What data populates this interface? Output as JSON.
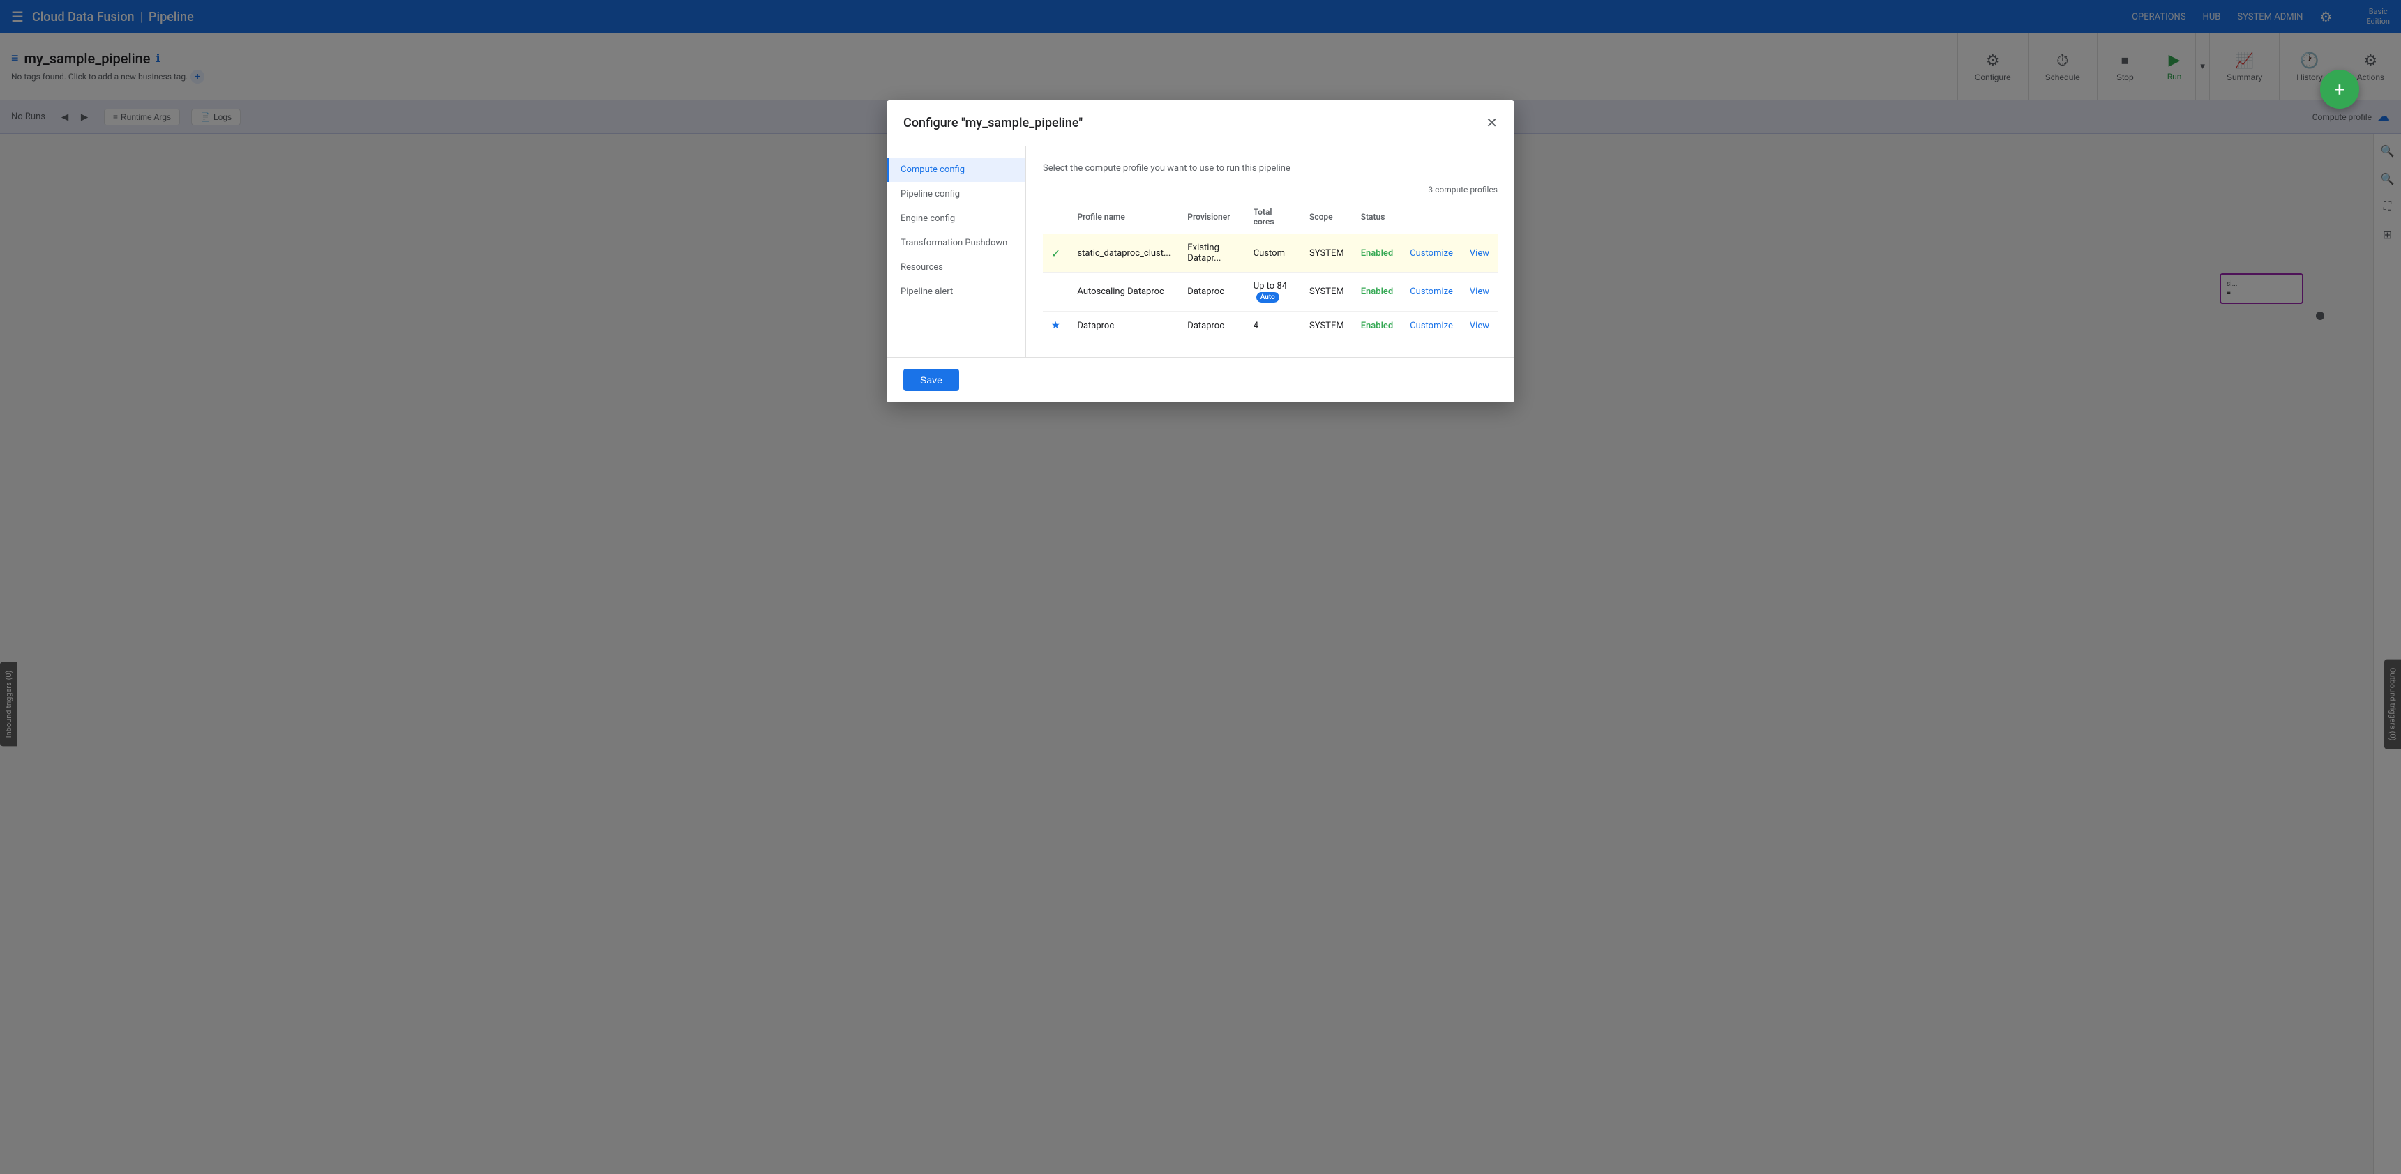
{
  "app": {
    "brand": "Cloud Data Fusion",
    "separator": "|",
    "section": "Pipeline",
    "edition": "Basic\nEdition"
  },
  "topnav": {
    "operations": "OPERATIONS",
    "hub": "HUB",
    "system_admin": "SYSTEM ADMIN"
  },
  "pipeline": {
    "name": "my_sample_pipeline",
    "tags_placeholder": "No tags found. Click to add a new business tag.",
    "add_tag_icon": "+"
  },
  "toolbar": {
    "configure_label": "Configure",
    "schedule_label": "Schedule",
    "stop_label": "Stop",
    "run_label": "Run",
    "summary_label": "Summary",
    "history_label": "History",
    "actions_label": "Actions"
  },
  "run_history": {
    "no_runs": "No Runs",
    "runtime_args": "Runtime Args",
    "logs": "Logs",
    "compute_profile": "Compute profile"
  },
  "modal": {
    "title": "Configure \"my_sample_pipeline\"",
    "description": "Select the compute profile you want to use to run this pipeline",
    "profiles_count": "3 compute profiles",
    "nav_items": [
      {
        "id": "compute-config",
        "label": "Compute config",
        "active": true
      },
      {
        "id": "pipeline-config",
        "label": "Pipeline config",
        "active": false
      },
      {
        "id": "engine-config",
        "label": "Engine config",
        "active": false
      },
      {
        "id": "transformation-pushdown",
        "label": "Transformation Pushdown",
        "active": false
      },
      {
        "id": "resources",
        "label": "Resources",
        "active": false
      },
      {
        "id": "pipeline-alert",
        "label": "Pipeline alert",
        "active": false
      }
    ],
    "table": {
      "headers": [
        "Profile name",
        "Provisioner",
        "Total cores",
        "Scope",
        "Status",
        "",
        ""
      ],
      "rows": [
        {
          "selected": true,
          "check": "✓",
          "profile_name": "static_dataproc_clust...",
          "provisioner": "Existing Datapr...",
          "total_cores": "Custom",
          "scope": "SYSTEM",
          "status": "Enabled",
          "customize": "Customize",
          "view": "View",
          "badge": null,
          "star": null
        },
        {
          "selected": false,
          "check": null,
          "profile_name": "Autoscaling Dataproc",
          "provisioner": "Dataproc",
          "total_cores": "Up to 84",
          "scope": "SYSTEM",
          "status": "Enabled",
          "customize": "Customize",
          "view": "View",
          "badge": "Auto",
          "star": null
        },
        {
          "selected": false,
          "check": null,
          "profile_name": "Dataproc",
          "provisioner": "Dataproc",
          "total_cores": "4",
          "scope": "SYSTEM",
          "status": "Enabled",
          "customize": "Customize",
          "view": "View",
          "badge": null,
          "star": "★"
        }
      ]
    },
    "save_label": "Save"
  },
  "triggers": {
    "inbound": "Inbound triggers (0)",
    "outbound": "Outbound triggers (0)"
  }
}
